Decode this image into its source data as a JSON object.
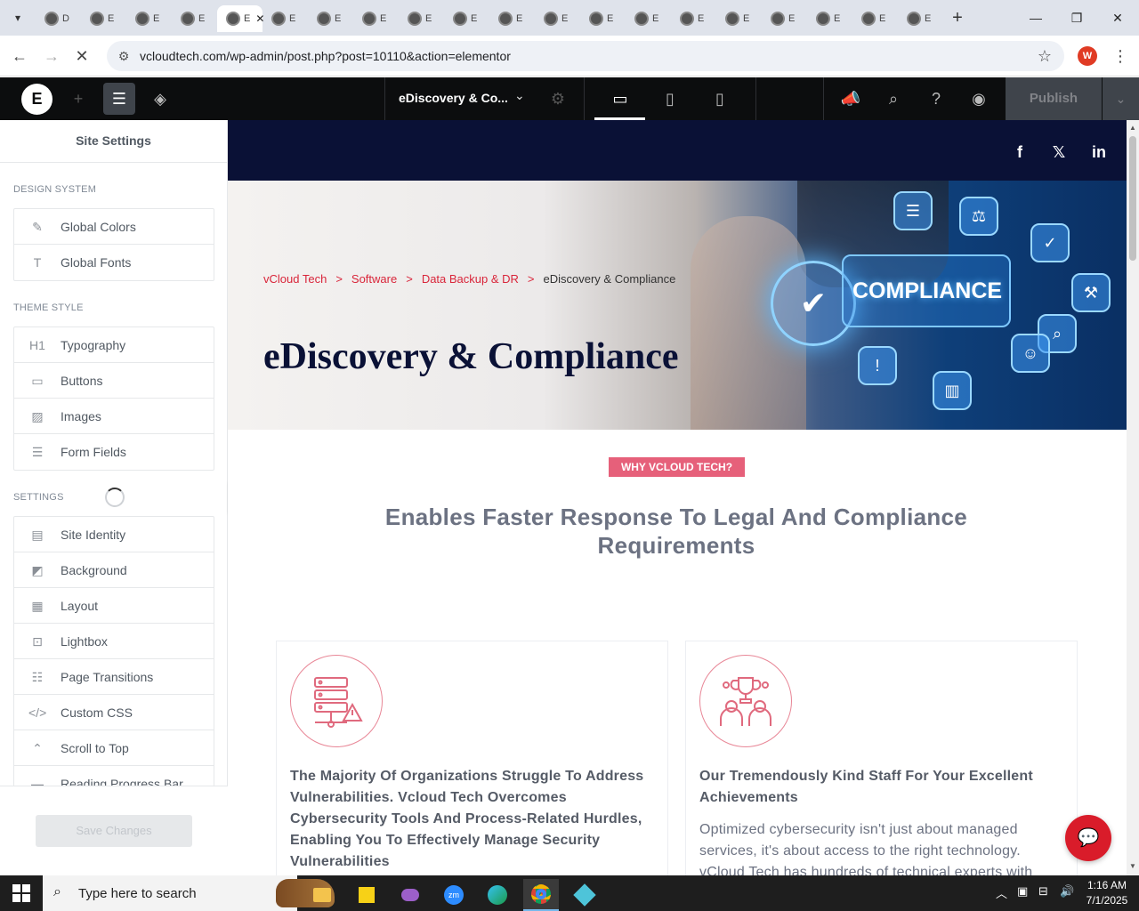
{
  "browser": {
    "tabs": [
      {
        "label": "D",
        "active": false
      },
      {
        "label": "E",
        "active": false
      },
      {
        "label": "E",
        "active": false
      },
      {
        "label": "E",
        "active": false
      },
      {
        "label": "E",
        "active": true
      },
      {
        "label": "E",
        "active": false
      },
      {
        "label": "E",
        "active": false
      },
      {
        "label": "E",
        "active": false
      },
      {
        "label": "E",
        "active": false
      },
      {
        "label": "E",
        "active": false
      },
      {
        "label": "E",
        "active": false
      },
      {
        "label": "E",
        "active": false
      },
      {
        "label": "E",
        "active": false
      },
      {
        "label": "E",
        "active": false
      },
      {
        "label": "E",
        "active": false
      },
      {
        "label": "E",
        "active": false
      },
      {
        "label": "E",
        "active": false
      },
      {
        "label": "E",
        "active": false
      },
      {
        "label": "E",
        "active": false
      },
      {
        "label": "E",
        "active": false
      }
    ],
    "url": "vcloudtech.com/wp-admin/post.php?post=10110&action=elementor",
    "profile_initial": "W"
  },
  "editor": {
    "doc_title": "eDiscovery & Co...",
    "publish_label": "Publish"
  },
  "sidebar": {
    "title": "Site Settings",
    "design_system_label": "DESIGN SYSTEM",
    "design_system": [
      {
        "label": "Global Colors",
        "icon": "brush-icon"
      },
      {
        "label": "Global Fonts",
        "icon": "font-icon"
      }
    ],
    "theme_style_label": "THEME STYLE",
    "theme_style": [
      {
        "label": "Typography",
        "icon": "heading-icon"
      },
      {
        "label": "Buttons",
        "icon": "button-icon"
      },
      {
        "label": "Images",
        "icon": "image-icon"
      },
      {
        "label": "Form Fields",
        "icon": "form-icon"
      }
    ],
    "settings_label": "SETTINGS",
    "settings": [
      {
        "label": "Site Identity",
        "icon": "id-card-icon"
      },
      {
        "label": "Background",
        "icon": "background-icon"
      },
      {
        "label": "Layout",
        "icon": "layout-icon"
      },
      {
        "label": "Lightbox",
        "icon": "lightbox-icon"
      },
      {
        "label": "Page Transitions",
        "icon": "transition-icon"
      },
      {
        "label": "Custom CSS",
        "icon": "code-icon"
      },
      {
        "label": "Scroll to Top",
        "icon": "scroll-top-icon"
      },
      {
        "label": "Reading Progress Bar",
        "icon": "progress-bar-icon"
      }
    ],
    "save_label": "Save Changes"
  },
  "page": {
    "breadcrumb": [
      {
        "label": "vCloud Tech",
        "link": true
      },
      {
        "label": "Software",
        "link": true
      },
      {
        "label": "Data Backup & DR",
        "link": true
      },
      {
        "label": "eDiscovery & Compliance",
        "link": false
      }
    ],
    "breadcrumb_sep": ">",
    "hero_title": "eDiscovery & Compliance",
    "hero_image_text": "COMPLIANCE",
    "why_badge": "WHY VCLOUD TECH?",
    "section_title": "Enables Faster Response To Legal And Compliance Requirements",
    "cards": [
      {
        "heading": "The Majority Of Organizations Struggle To Address Vulnerabilities. Vcloud Tech Overcomes Cybersecurity Tools And Process-Related Hurdles, Enabling You To Effectively Manage Security Vulnerabilities",
        "body": ""
      },
      {
        "heading": "Our Tremendously Kind Staff For Your Excellent Achievements",
        "body": "Optimized cybersecurity isn't just about managed services, it's about access to the right technology. vCloud Tech has hundreds of technical experts with"
      }
    ]
  },
  "taskbar": {
    "search_placeholder": "Type here to search",
    "time": "1:16 AM",
    "date": "7/1/2025"
  },
  "colors": {
    "brand_red": "#d9253a",
    "navy": "#0a1136",
    "badge_pink": "#e6607a",
    "elementor_dark": "#0c0d0e"
  }
}
